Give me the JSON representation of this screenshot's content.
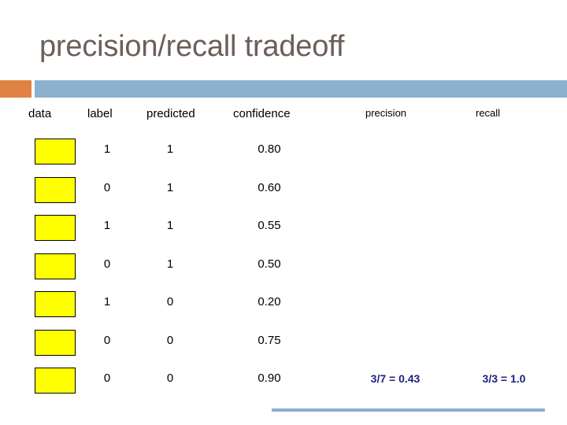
{
  "slide": {
    "title": "precision/recall tradeoff"
  },
  "accent": {
    "square_color": "#E08244",
    "bar_color": "#8CB0D0"
  },
  "table": {
    "headers": {
      "data": "data",
      "label": "label",
      "predicted": "predicted",
      "confidence": "confidence",
      "precision": "precision",
      "recall": "recall"
    },
    "rows": [
      {
        "data_swatch": "yellow-swatch",
        "label": "1",
        "predicted": "1",
        "confidence": "0.80",
        "precision": "",
        "recall": ""
      },
      {
        "data_swatch": "yellow-swatch",
        "label": "0",
        "predicted": "1",
        "confidence": "0.60",
        "precision": "",
        "recall": ""
      },
      {
        "data_swatch": "yellow-swatch",
        "label": "1",
        "predicted": "1",
        "confidence": "0.55",
        "precision": "",
        "recall": ""
      },
      {
        "data_swatch": "yellow-swatch",
        "label": "0",
        "predicted": "1",
        "confidence": "0.50",
        "precision": "",
        "recall": ""
      },
      {
        "data_swatch": "yellow-swatch",
        "label": "1",
        "predicted": "0",
        "confidence": "0.20",
        "precision": "",
        "recall": ""
      },
      {
        "data_swatch": "yellow-swatch",
        "label": "0",
        "predicted": "0",
        "confidence": "0.75",
        "precision": "",
        "recall": ""
      },
      {
        "data_swatch": "yellow-swatch",
        "label": "0",
        "predicted": "0",
        "confidence": "0.90",
        "precision": "3/7 = 0.43",
        "recall": "3/3 = 1.0"
      }
    ],
    "swatch_color": "#FFFF00",
    "metric_color": "#1F2080"
  },
  "divider": {
    "color": "#8CB0D0"
  }
}
